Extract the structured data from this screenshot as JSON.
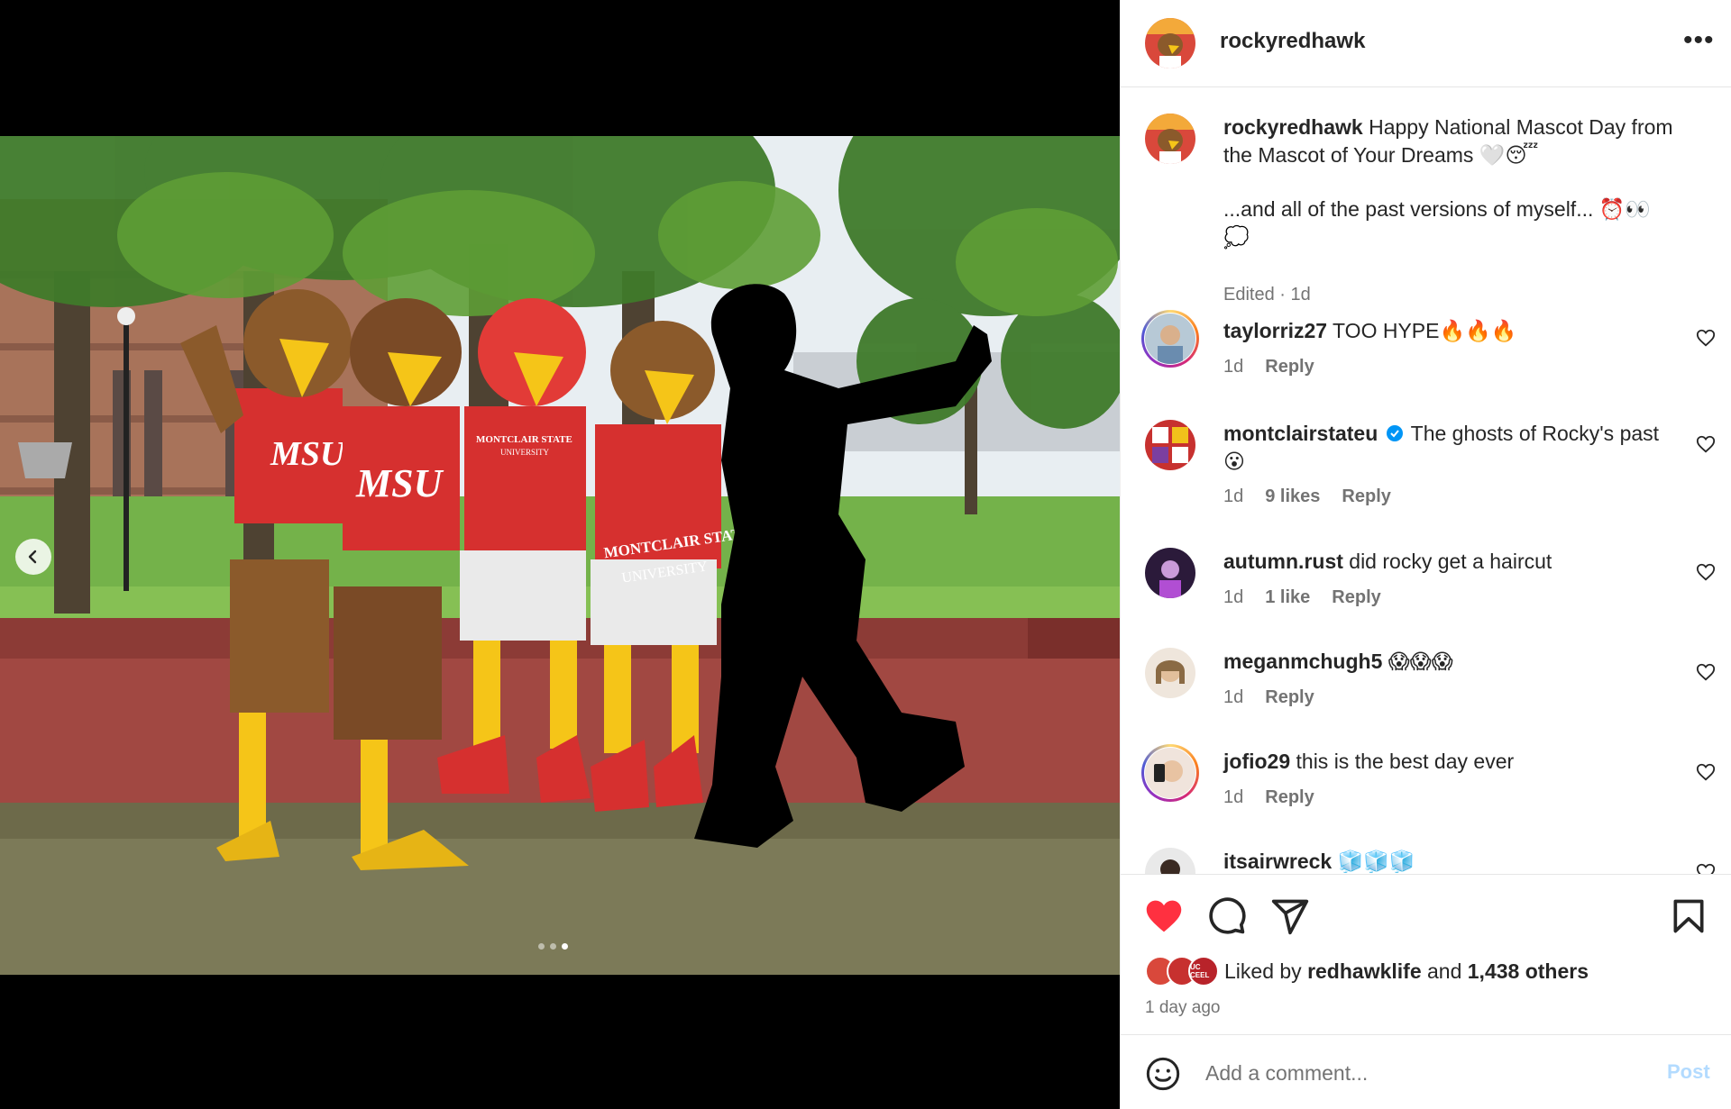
{
  "post": {
    "author": "rockyredhawk",
    "more_label": "•••",
    "caption_line1": "Happy National Mascot Day from the Mascot of Your Dreams 🤍😴",
    "caption_line2": "...and all of the past versions of myself... ⏰👀💭",
    "edited": "Edited · 1d"
  },
  "photo": {
    "jersey1": "MSU",
    "jersey2": "MSU",
    "jersey3_line1": "MONTCLAIR STATE",
    "jersey3_line2": "UNIVERSITY",
    "jersey4_line1": "MONTCLAIR STATE",
    "jersey4_line2": "UNIVERSITY",
    "carousel_count": 3,
    "carousel_active": 3
  },
  "comments": [
    {
      "user": "taylorriz27",
      "text": "TOO HYPE🔥🔥🔥",
      "time": "1d",
      "likes": "",
      "reply": "Reply",
      "ring": true
    },
    {
      "user": "montclairstateu",
      "verified": true,
      "text": "The ghosts of Rocky's past 😮",
      "time": "1d",
      "likes": "9 likes",
      "reply": "Reply",
      "ring": false
    },
    {
      "user": "autumn.rust",
      "text": "did rocky get a haircut",
      "time": "1d",
      "likes": "1 like",
      "reply": "Reply",
      "ring": false
    },
    {
      "user": "meganmchugh5",
      "text": "😱😱😱",
      "time": "1d",
      "likes": "",
      "reply": "Reply",
      "ring": false
    },
    {
      "user": "jofio29",
      "text": "this is the best day ever",
      "time": "1d",
      "likes": "",
      "reply": "Reply",
      "ring": true
    },
    {
      "user": "itsairwreck",
      "text": "🧊🧊🧊",
      "time": "",
      "likes": "",
      "reply": "",
      "ring": false
    }
  ],
  "likes": {
    "liked_by_prefix": "Liked by",
    "liked_by_user": "redhawklife",
    "and": "and",
    "others": "1,438 others",
    "avatar_badge": "UC CEEL",
    "time_ago": "1 day ago"
  },
  "composer": {
    "placeholder": "Add a comment...",
    "post_label": "Post"
  },
  "colors": {
    "like_red": "#ff3040",
    "post_disabled": "#b3dbff",
    "verified_blue": "#0095f6",
    "jersey_red": "#d6302f"
  },
  "icons": [
    "chevron-left-icon",
    "more-icon",
    "heart-icon",
    "comment-icon",
    "share-icon",
    "bookmark-icon",
    "emoji-icon",
    "verified-icon"
  ]
}
